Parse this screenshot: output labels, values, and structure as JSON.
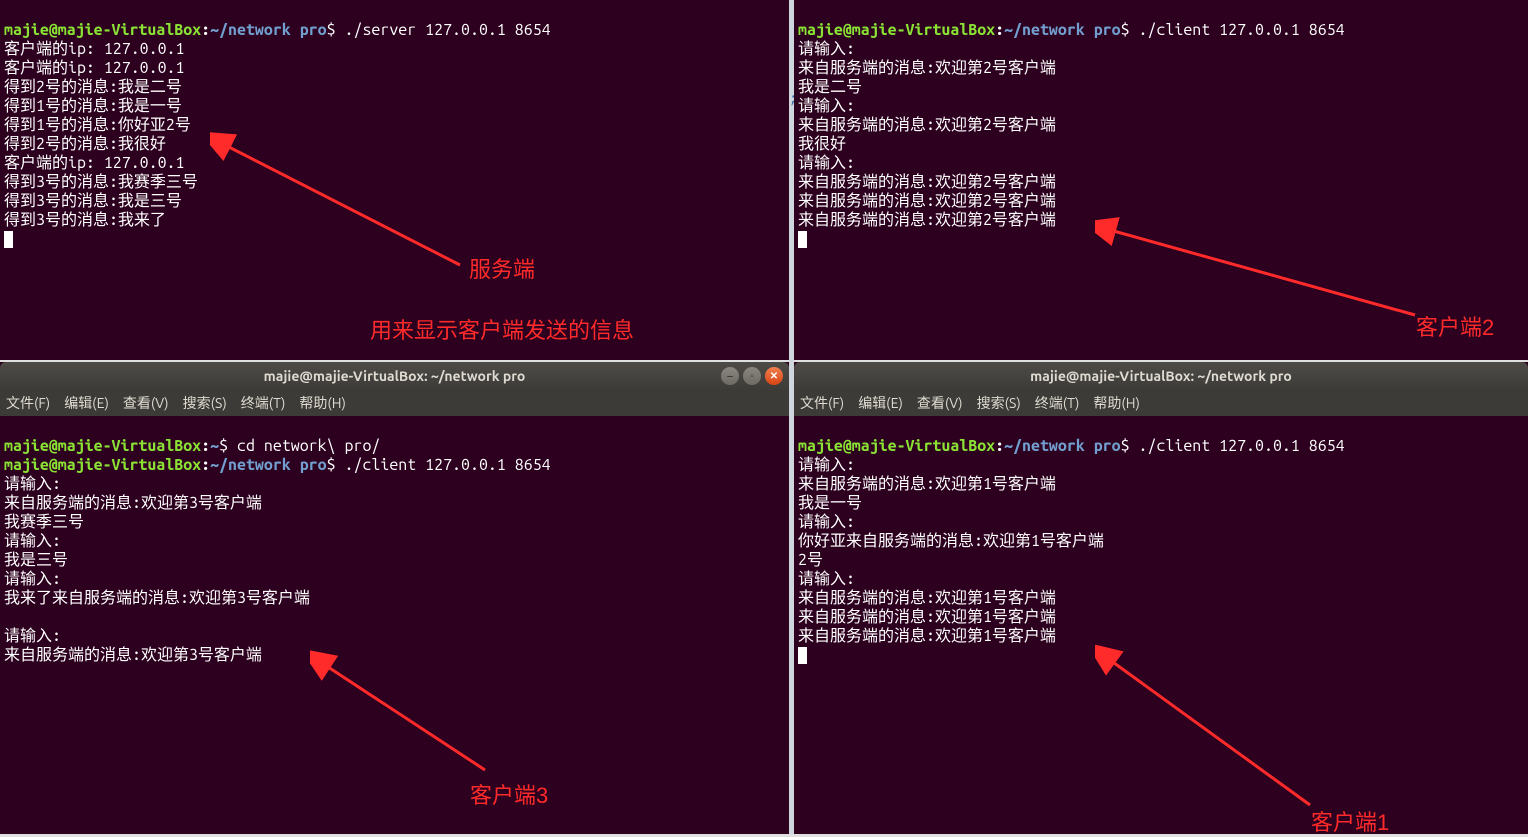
{
  "prompt": {
    "user": "majie",
    "host": "majie-VirtualBox",
    "home_path": "~",
    "net_path": "~/network pro",
    "dollar": "$"
  },
  "titlebar": "majie@majie-VirtualBox: ~/network pro",
  "menubar": {
    "file": "文件(F)",
    "edit": "编辑(E)",
    "view": "查看(V)",
    "search": "搜索(S)",
    "terminal": "终端(T)",
    "help": "帮助(H)"
  },
  "annotations": {
    "server_label": "服务端",
    "server_desc": "用来显示客户端发送的信息",
    "client1": "客户端1",
    "client2": "客户端2",
    "client3": "客户端3"
  },
  "tl": {
    "cmd": " ./server 127.0.0.1 8654",
    "lines": [
      "客户端的ip: 127.0.0.1",
      "客户端的ip: 127.0.0.1",
      "得到2号的消息:我是二号",
      "得到1号的消息:我是一号",
      "得到1号的消息:你好亚2号",
      "得到2号的消息:我很好",
      "客户端的ip: 127.0.0.1",
      "得到3号的消息:我赛季三号",
      "得到3号的消息:我是三号",
      "得到3号的消息:我来了"
    ]
  },
  "tr": {
    "cmd": " ./client 127.0.0.1 8654",
    "lines": [
      "请输入:",
      "来自服务端的消息:欢迎第2号客户端",
      "我是二号",
      "请输入:",
      "来自服务端的消息:欢迎第2号客户端",
      "我很好",
      "请输入:",
      "来自服务端的消息:欢迎第2号客户端",
      "来自服务端的消息:欢迎第2号客户端",
      "来自服务端的消息:欢迎第2号客户端"
    ]
  },
  "bl": {
    "cmd1": " cd network\\ pro/",
    "cmd2": " ./client 127.0.0.1 8654",
    "lines": [
      "请输入:",
      "来自服务端的消息:欢迎第3号客户端",
      "我赛季三号",
      "请输入:",
      "我是三号",
      "请输入:",
      "我来了来自服务端的消息:欢迎第3号客户端",
      "",
      "请输入:",
      "来自服务端的消息:欢迎第3号客户端"
    ]
  },
  "br": {
    "cmd": " ./client 127.0.0.1 8654",
    "lines": [
      "请输入:",
      "来自服务端的消息:欢迎第1号客户端",
      "我是一号",
      "请输入:",
      "你好亚来自服务端的消息:欢迎第1号客户端",
      "2号",
      "请输入:",
      "来自服务端的消息:欢迎第1号客户端",
      "来自服务端的消息:欢迎第1号客户端",
      "来自服务端的消息:欢迎第1号客户端"
    ]
  }
}
